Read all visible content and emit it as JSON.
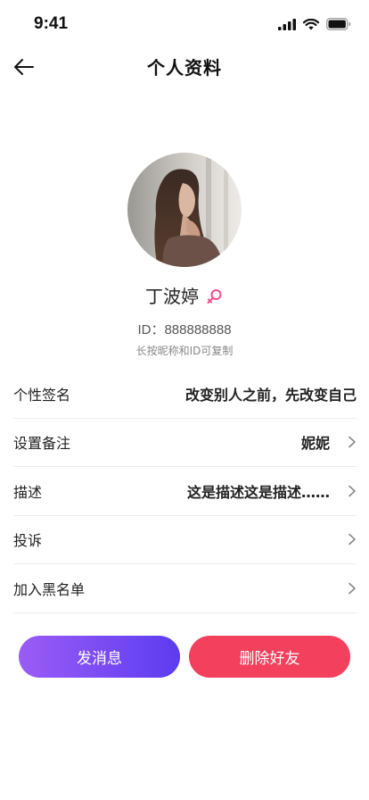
{
  "status_bar": {
    "time": "9:41"
  },
  "nav": {
    "title": "个人资料"
  },
  "profile": {
    "nickname": "丁波婷",
    "user_id": "ID：888888888",
    "copy_hint": "长按昵称和ID可复制"
  },
  "rows": [
    {
      "label": "个性签名",
      "value": "改变别人之前，先改变自己"
    },
    {
      "label": "设置备注",
      "value": "妮妮"
    },
    {
      "label": "描述",
      "value": "这是描述这是描述……"
    },
    {
      "label": "投诉",
      "value": ""
    },
    {
      "label": "加入黑名单",
      "value": ""
    }
  ],
  "actions": {
    "message_label": "发消息",
    "delete_label": "删除好友"
  },
  "colors": {
    "accent_purple": "#7b4cf5",
    "accent_red": "#f2405d",
    "gender_pink": "#f0508a"
  },
  "icons": [
    "signal-icon",
    "wifi-icon",
    "battery-icon",
    "back-arrow-icon",
    "female-gender-icon",
    "chevron-right-icon"
  ]
}
